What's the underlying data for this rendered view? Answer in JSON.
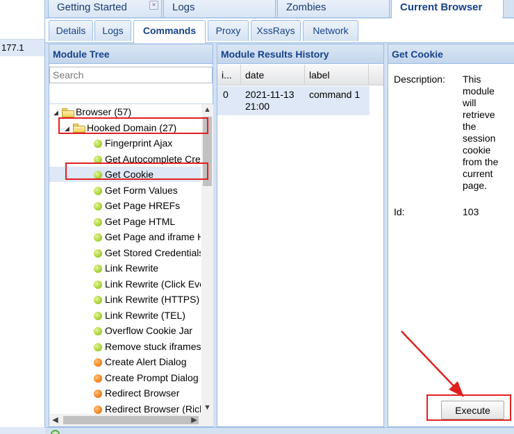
{
  "left_pane": {
    "row_text": "177.1"
  },
  "top_tabs": [
    {
      "label": "Getting Started",
      "close": "×"
    },
    {
      "label": "Logs"
    },
    {
      "label": "Zombies"
    },
    {
      "label": "Current Browser"
    }
  ],
  "sub_tabs": [
    "Details",
    "Logs",
    "Commands",
    "Proxy",
    "XssRays",
    "Network"
  ],
  "module_tree": {
    "title": "Module Tree",
    "search_placeholder": "Search",
    "items": [
      {
        "label": "Browser (57)",
        "type": "folder"
      },
      {
        "label": "Hooked Domain (27)",
        "type": "folder"
      },
      {
        "label": "Fingerprint Ajax",
        "status": "green"
      },
      {
        "label": "Get Autocomplete Creds",
        "status": "green"
      },
      {
        "label": "Get Cookie",
        "status": "green"
      },
      {
        "label": "Get Form Values",
        "status": "green"
      },
      {
        "label": "Get Page HREFs",
        "status": "green"
      },
      {
        "label": "Get Page HTML",
        "status": "green"
      },
      {
        "label": "Get Page and iframe HTML",
        "status": "green"
      },
      {
        "label": "Get Stored Credentials",
        "status": "green"
      },
      {
        "label": "Link Rewrite",
        "status": "green"
      },
      {
        "label": "Link Rewrite (Click Events)",
        "status": "green"
      },
      {
        "label": "Link Rewrite (HTTPS)",
        "status": "green"
      },
      {
        "label": "Link Rewrite (TEL)",
        "status": "green"
      },
      {
        "label": "Overflow Cookie Jar",
        "status": "green"
      },
      {
        "label": "Remove stuck iframes",
        "status": "green"
      },
      {
        "label": "Create Alert Dialog",
        "status": "orange"
      },
      {
        "label": "Create Prompt Dialog",
        "status": "orange"
      },
      {
        "label": "Redirect Browser",
        "status": "orange"
      },
      {
        "label": "Redirect Browser (Rickroll)",
        "status": "orange"
      }
    ]
  },
  "results": {
    "title": "Module Results History",
    "columns": [
      "i...",
      "date",
      "label"
    ],
    "rows": [
      {
        "id": "0",
        "date_line1": "2021-11-13",
        "date_line2": "21:00",
        "label": "command 1"
      }
    ]
  },
  "cookie": {
    "title": "Get Cookie",
    "description_label": "Description:",
    "description": "This module will retrieve the session cookie from the current page.",
    "id_label": "Id:",
    "id": "103",
    "execute_label": "Execute"
  },
  "colors": {
    "annotation": "#e0201e",
    "accent": "#15428b",
    "selected": "#dfe8f6"
  }
}
